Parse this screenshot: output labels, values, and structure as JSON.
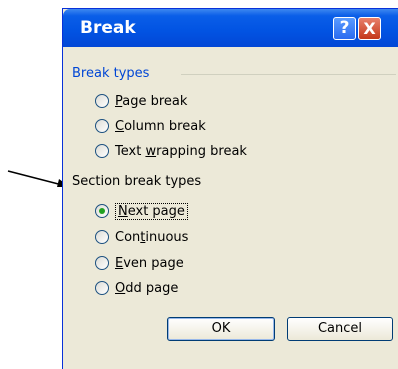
{
  "window": {
    "title": "Break",
    "help_glyph": "?",
    "close_glyph": "X"
  },
  "break_types": {
    "label": "Break types",
    "options": [
      {
        "key": "P",
        "rest": "age break",
        "pre": ""
      },
      {
        "key": "C",
        "rest": "olumn break",
        "pre": ""
      },
      {
        "pre": "Text ",
        "key": "w",
        "rest": "rapping break"
      }
    ]
  },
  "section_break_types": {
    "label": "Section break types",
    "options": [
      {
        "key": "N",
        "rest": "ext page",
        "pre": "",
        "selected": true
      },
      {
        "pre": "Con",
        "key": "t",
        "rest": "inuous"
      },
      {
        "key": "E",
        "rest": "ven page",
        "pre": ""
      },
      {
        "key": "O",
        "rest": "dd page",
        "pre": ""
      }
    ]
  },
  "buttons": {
    "ok": "OK",
    "cancel": "Cancel"
  },
  "colors": {
    "titlebar": "#0254e3",
    "dialog_bg": "#ece9d8",
    "group_label": "#0046d5",
    "selected_dot": "#21a121"
  },
  "annotation": {
    "type": "arrow",
    "points_to": "Section break types"
  }
}
